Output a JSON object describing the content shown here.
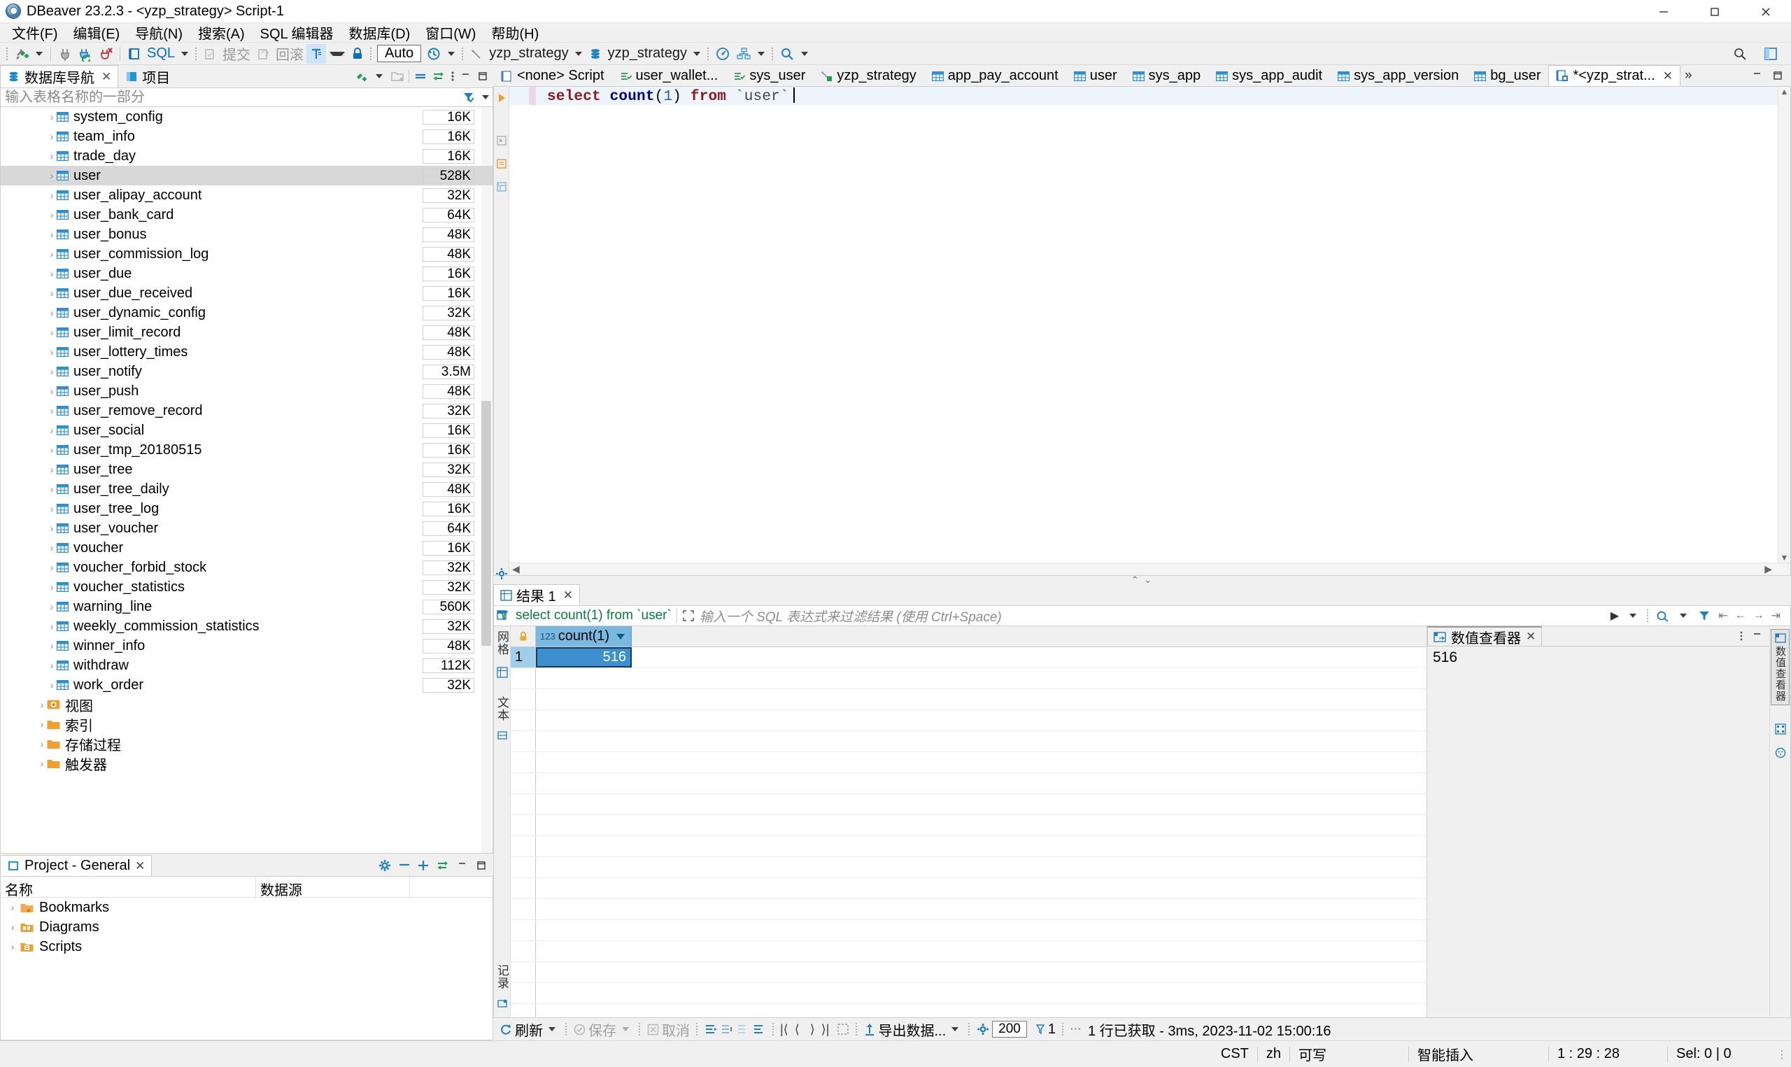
{
  "window": {
    "title": "DBeaver 23.2.3 - <yzp_strategy> Script-1",
    "minimize": "–",
    "maximize": "❐",
    "close": "✕"
  },
  "menubar": {
    "items": [
      {
        "label": "文件(F)",
        "name": "menu-file"
      },
      {
        "label": "编辑(E)",
        "name": "menu-edit"
      },
      {
        "label": "导航(N)",
        "name": "menu-navigate"
      },
      {
        "label": "搜索(A)",
        "name": "menu-search"
      },
      {
        "label": "SQL 编辑器",
        "name": "menu-sql-editor"
      },
      {
        "label": "数据库(D)",
        "name": "menu-database"
      },
      {
        "label": "窗口(W)",
        "name": "menu-window"
      },
      {
        "label": "帮助(H)",
        "name": "menu-help"
      }
    ]
  },
  "toolbar": {
    "sql_label": "SQL",
    "commit_label": "提交",
    "rollback_label": "回滚",
    "auto_label": "Auto",
    "connection": "yzp_strategy",
    "database": "yzp_strategy",
    "icons": {
      "new_connection": "new-connection-icon",
      "disconnect": "disconnect-icon",
      "refresh_connection": "refresh-connection-icon",
      "disconnect_all": "disconnect-all-icon",
      "sql_editor": "sql-editor-icon",
      "commit": "commit-icon",
      "rollback": "rollback-icon",
      "transaction_mode": "transaction-mode-icon",
      "lock": "lock-icon",
      "history": "history-icon",
      "connection_picker": "connection-picker-icon",
      "database_picker": "database-picker-icon",
      "dashboard": "dashboard-icon",
      "er_diagram": "er-diagram-icon",
      "search": "search-icon",
      "panel_min": "minimize-icon",
      "panel_max": "maximize-icon"
    }
  },
  "navigator": {
    "tabs": [
      {
        "label": "数据库导航",
        "name": "tab-database-navigator",
        "active": true,
        "closable": true
      },
      {
        "label": "项目",
        "name": "tab-projects",
        "active": false,
        "closable": false
      }
    ],
    "filter_placeholder": "输入表格名称的一部分",
    "filter_value": "",
    "tree": [
      {
        "label": "system_config",
        "size": "16K",
        "type": "table",
        "selected": false
      },
      {
        "label": "team_info",
        "size": "16K",
        "type": "table",
        "selected": false
      },
      {
        "label": "trade_day",
        "size": "16K",
        "type": "table",
        "selected": false
      },
      {
        "label": "user",
        "size": "528K",
        "type": "table",
        "selected": true
      },
      {
        "label": "user_alipay_account",
        "size": "32K",
        "type": "table",
        "selected": false
      },
      {
        "label": "user_bank_card",
        "size": "64K",
        "type": "table",
        "selected": false
      },
      {
        "label": "user_bonus",
        "size": "48K",
        "type": "table",
        "selected": false
      },
      {
        "label": "user_commission_log",
        "size": "48K",
        "type": "table",
        "selected": false
      },
      {
        "label": "user_due",
        "size": "16K",
        "type": "table",
        "selected": false
      },
      {
        "label": "user_due_received",
        "size": "16K",
        "type": "table",
        "selected": false
      },
      {
        "label": "user_dynamic_config",
        "size": "32K",
        "type": "table",
        "selected": false
      },
      {
        "label": "user_limit_record",
        "size": "48K",
        "type": "table",
        "selected": false
      },
      {
        "label": "user_lottery_times",
        "size": "48K",
        "type": "table",
        "selected": false
      },
      {
        "label": "user_notify",
        "size": "3.5M",
        "type": "table",
        "selected": false
      },
      {
        "label": "user_push",
        "size": "48K",
        "type": "table",
        "selected": false
      },
      {
        "label": "user_remove_record",
        "size": "32K",
        "type": "table",
        "selected": false
      },
      {
        "label": "user_social",
        "size": "16K",
        "type": "table",
        "selected": false
      },
      {
        "label": "user_tmp_20180515",
        "size": "16K",
        "type": "table",
        "selected": false
      },
      {
        "label": "user_tree",
        "size": "32K",
        "type": "table",
        "selected": false
      },
      {
        "label": "user_tree_daily",
        "size": "48K",
        "type": "table",
        "selected": false
      },
      {
        "label": "user_tree_log",
        "size": "16K",
        "type": "table",
        "selected": false
      },
      {
        "label": "user_voucher",
        "size": "64K",
        "type": "table",
        "selected": false
      },
      {
        "label": "voucher",
        "size": "16K",
        "type": "table",
        "selected": false
      },
      {
        "label": "voucher_forbid_stock",
        "size": "32K",
        "type": "table",
        "selected": false
      },
      {
        "label": "voucher_statistics",
        "size": "32K",
        "type": "table",
        "selected": false
      },
      {
        "label": "warning_line",
        "size": "560K",
        "type": "table",
        "selected": false
      },
      {
        "label": "weekly_commission_statistics",
        "size": "32K",
        "type": "table",
        "selected": false
      },
      {
        "label": "winner_info",
        "size": "48K",
        "type": "table",
        "selected": false
      },
      {
        "label": "withdraw",
        "size": "112K",
        "type": "table",
        "selected": false
      },
      {
        "label": "work_order",
        "size": "32K",
        "type": "table",
        "selected": false
      },
      {
        "label": "视图",
        "size": "",
        "type": "views",
        "selected": false
      },
      {
        "label": "索引",
        "size": "",
        "type": "folder",
        "selected": false
      },
      {
        "label": "存储过程",
        "size": "",
        "type": "folder",
        "selected": false
      },
      {
        "label": "触发器",
        "size": "",
        "type": "folder",
        "selected": false
      }
    ]
  },
  "project_panel": {
    "tab_label": "Project - General",
    "columns": [
      "名称",
      "数据源"
    ],
    "rows": [
      {
        "name": "Bookmarks",
        "datasource": "",
        "icon": "bookmarks-folder-icon"
      },
      {
        "name": "Diagrams",
        "datasource": "",
        "icon": "diagrams-folder-icon"
      },
      {
        "name": "Scripts",
        "datasource": "",
        "icon": "scripts-folder-icon"
      }
    ]
  },
  "editor": {
    "tabs": [
      {
        "label": "<none> Script",
        "icon": "script-icon",
        "active": false,
        "closable": false
      },
      {
        "label": "user_wallet...",
        "icon": "sql-console-icon",
        "active": false,
        "closable": false
      },
      {
        "label": "sys_user",
        "icon": "sql-console-icon",
        "active": false,
        "closable": false
      },
      {
        "label": "yzp_strategy",
        "icon": "connection-icon",
        "active": false,
        "closable": false
      },
      {
        "label": "app_pay_account",
        "icon": "table-icon",
        "active": false,
        "closable": false
      },
      {
        "label": "user",
        "icon": "table-icon",
        "active": false,
        "closable": false
      },
      {
        "label": "sys_app",
        "icon": "table-icon",
        "active": false,
        "closable": false
      },
      {
        "label": "sys_app_audit",
        "icon": "table-icon",
        "active": false,
        "closable": false
      },
      {
        "label": "sys_app_version",
        "icon": "table-icon",
        "active": false,
        "closable": false
      },
      {
        "label": "bg_user",
        "icon": "table-icon",
        "active": false,
        "closable": false
      },
      {
        "label": "*<yzp_strat...",
        "icon": "sql-script-icon",
        "active": true,
        "closable": true
      }
    ],
    "more_tabs": "»",
    "sql": {
      "select": "select",
      "count": "count",
      "paren_open": "(",
      "one": "1",
      "paren_close": ")",
      "from": "from",
      "table": "`user`"
    }
  },
  "results": {
    "tab_label": "结果 1",
    "query_text": "select count(1) from `user`",
    "filter_placeholder": "输入一个 SQL 表达式来过滤结果 (使用 Ctrl+Space)",
    "grid": {
      "columns": [
        {
          "label": "count(1)",
          "type_badge": "123"
        }
      ],
      "rows": [
        {
          "num": "1",
          "values": [
            "516"
          ]
        }
      ]
    },
    "value_viewer": {
      "title": "数值查看器",
      "value": "516"
    },
    "side_labels": {
      "grid": "网格",
      "text": "文本",
      "record": "记录"
    },
    "toolbar": {
      "refresh": "刷新",
      "save": "保存",
      "cancel": "取消",
      "export": "导出数据...",
      "fetch_size": "200",
      "page": "1",
      "status": "1 行已获取 - 3ms, 2023-11-02 15:00:16"
    }
  },
  "statusbar": {
    "timezone": "CST",
    "language": "zh",
    "writable": "可写",
    "insert_mode": "智能插入",
    "position": "1 : 29 : 28",
    "selection": "Sel: 0 | 0"
  },
  "colors": {
    "accent": "#0a6fbd",
    "selection": "#3d8fce",
    "header": "#7ab8e0",
    "keyword": "#8b1a1a",
    "function": "#00008b",
    "green": "#0a7a3d",
    "folder": "#f0a030"
  }
}
